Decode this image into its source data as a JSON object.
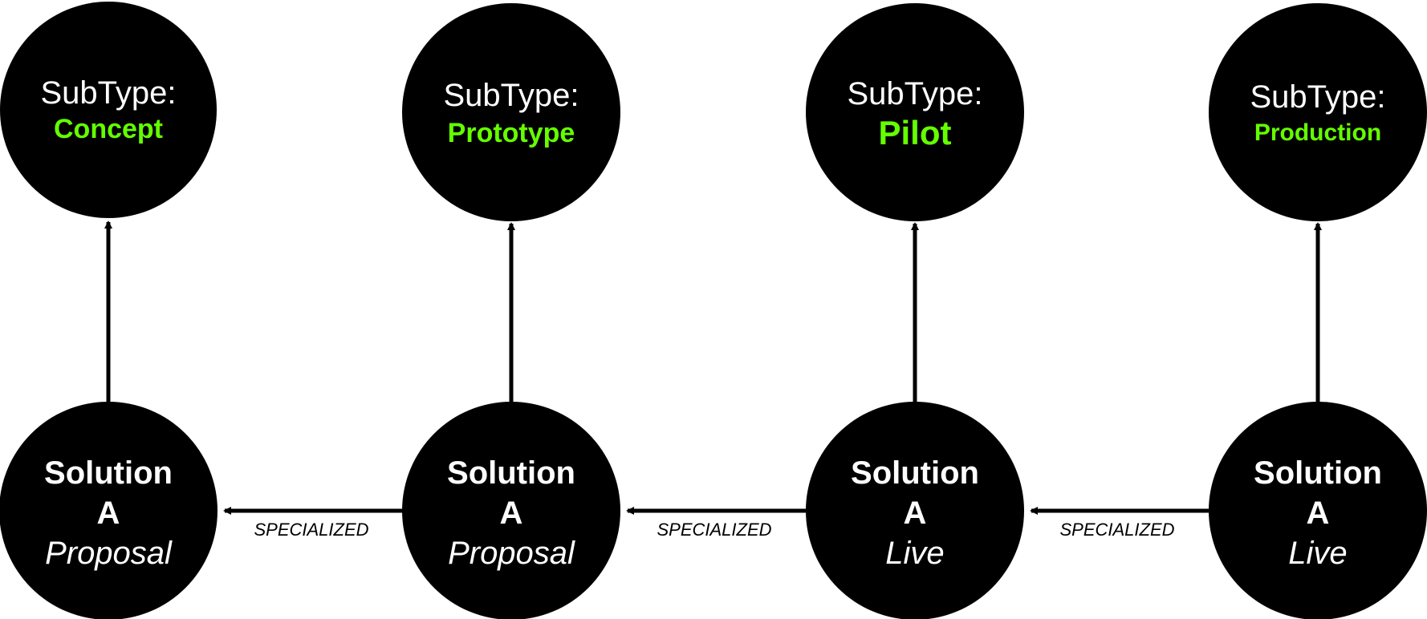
{
  "subtypes": [
    {
      "label": "SubType:",
      "value": "Concept"
    },
    {
      "label": "SubType:",
      "value": "Prototype"
    },
    {
      "label": "SubType:",
      "value": "Pilot"
    },
    {
      "label": "SubType:",
      "value": "Production"
    }
  ],
  "solutions": [
    {
      "line1": "Solution",
      "line2": "A",
      "state": "Proposal"
    },
    {
      "line1": "Solution",
      "line2": "A",
      "state": "Proposal"
    },
    {
      "line1": "Solution",
      "line2": "A",
      "state": "Live"
    },
    {
      "line1": "Solution",
      "line2": "A",
      "state": "Live"
    }
  ],
  "edges": [
    {
      "label": "SPECIALIZED"
    },
    {
      "label": "SPECIALIZED"
    },
    {
      "label": "SPECIALIZED"
    }
  ],
  "colors": {
    "node_fill": "#000000",
    "node_text": "#ffffff",
    "subtype_value": "#64ff00",
    "edge": "#000000"
  }
}
